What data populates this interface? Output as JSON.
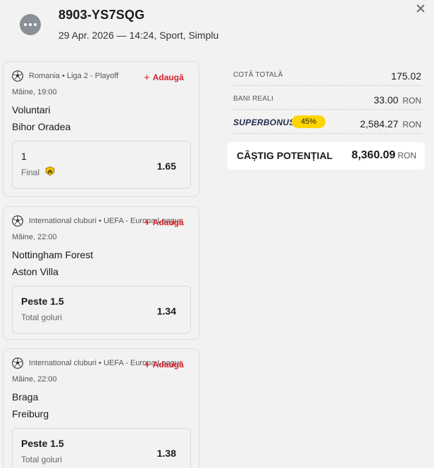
{
  "header": {
    "ticket_code": "8903-YS7SQG",
    "meta": "29 Apr. 2026 — 14:24, Sport, Simplu"
  },
  "bets": [
    {
      "competition": "Romania • Liga 2 - Playoff",
      "add_label": "Adaugă",
      "time": "Mâine, 19:00",
      "home": "Voluntari",
      "away": "Bihor Oradea",
      "selection": "1",
      "market": "Final",
      "odds": "1.65"
    },
    {
      "competition": "International cluburi • UEFA - Europa League",
      "add_label": "Adaugă",
      "time": "Mâine, 22:00",
      "home": "Nottingham Forest",
      "away": "Aston Villa",
      "selection": "Peste 1.5",
      "market": "Total goluri",
      "odds": "1.34"
    },
    {
      "competition": "International cluburi • UEFA - Europa League",
      "add_label": "Adaugă",
      "time": "Mâine, 22:00",
      "home": "Braga",
      "away": "Freiburg",
      "selection": "Peste 1.5",
      "market": "Total goluri",
      "odds": "1.38"
    }
  ],
  "summary": {
    "total_odds_label": "COTĂ TOTALĂ",
    "total_odds": "175.02",
    "stake_label": "BANI REALI",
    "stake": "33.00",
    "currency": "RON",
    "superbonus_label": "SUPERBONUS",
    "superbonus_pct": "45%",
    "superbonus_value": "2,584.27",
    "win_label": "CÂȘTIG POTENȚIAL",
    "win_value": "8,360.09"
  },
  "colors": {
    "accent_red": "#d6232f",
    "superbonus_yellow": "#ffd500",
    "background": "#f2f2f2"
  },
  "icons": [
    "more-options-icon",
    "close-icon",
    "soccer-ball-icon",
    "plus-icon",
    "final-badge-icon"
  ]
}
